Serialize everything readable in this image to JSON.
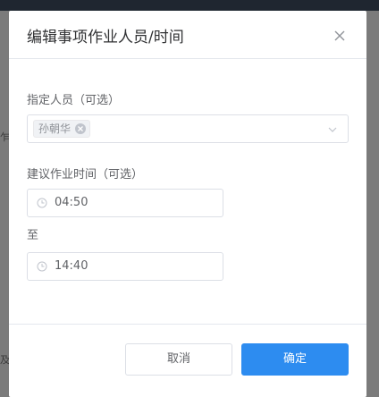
{
  "dialog": {
    "title": "编辑事项作业人员/时间",
    "assignee_label": "指定人员（可选）",
    "assignees": [
      "孙朝华"
    ],
    "time_label": "建议作业时间（可选）",
    "start_time": "04:50",
    "to_label": "至",
    "end_time": "14:40",
    "cancel_label": "取消",
    "confirm_label": "确定"
  },
  "backdrop": {
    "fragment_left": "乍",
    "fragment_bottom": "及"
  },
  "colors": {
    "primary": "#2d8cf0",
    "overlay": "#7b7b7b",
    "border": "#dcdfe6"
  },
  "icons": [
    "close-icon",
    "tag-close-icon",
    "chevron-down-icon",
    "clock-icon"
  ]
}
